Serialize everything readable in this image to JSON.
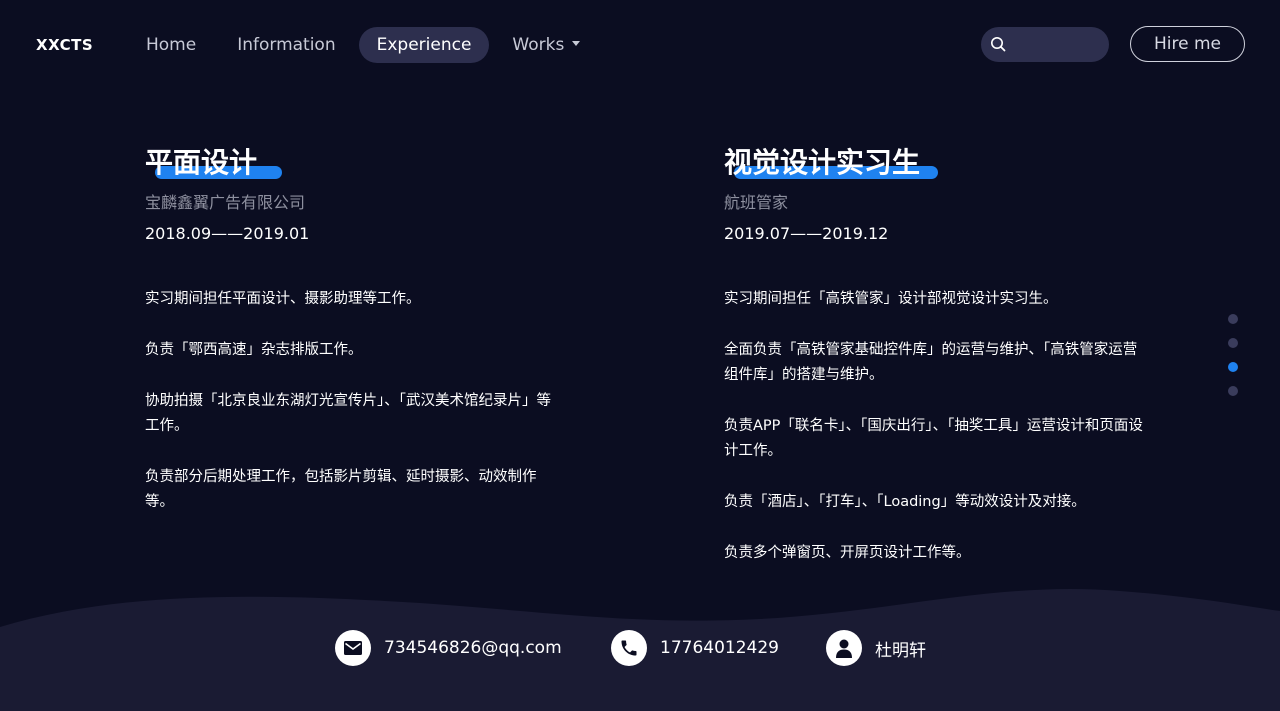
{
  "brand": {
    "logo": "XXCTS"
  },
  "nav": {
    "items": [
      {
        "label": "Home"
      },
      {
        "label": "Information"
      },
      {
        "label": "Experience"
      },
      {
        "label": "Works"
      }
    ]
  },
  "search": {
    "placeholder": ""
  },
  "hire_button": {
    "label": "Hire me"
  },
  "accent_color": "#1f82f0",
  "experience": [
    {
      "title": "平面设计",
      "company": "宝麟鑫翼广告有限公司",
      "period": "2018.09——2019.01",
      "duties": [
        "实习期间担任平面设计、摄影助理等工作。",
        "负责「鄂西高速」杂志排版工作。",
        "协助拍摄「北京良业东湖灯光宣传片」、「武汉美术馆纪录片」等工作。",
        "负责部分后期处理工作，包括影片剪辑、延时摄影、动效制作等。"
      ]
    },
    {
      "title": "视觉设计实习生",
      "company": "航班管家",
      "period": "2019.07——2019.12",
      "duties": [
        "实习期间担任「高铁管家」设计部视觉设计实习生。",
        "全面负责「高铁管家基础控件库」的运营与维护、「高铁管家运营组件库」的搭建与维护。",
        "负责APP「联名卡」、「国庆出行」、「抽奖工具」运营设计和页面设计工作。",
        "负责「酒店」、「打车」、「Loading」等动效设计及对接。",
        "负责多个弹窗页、开屏页设计工作等。"
      ]
    }
  ],
  "pagination": {
    "total": 4,
    "active_index": 2
  },
  "contact": {
    "email": "734546826@qq.com",
    "phone": "17764012429",
    "name": "杜明轩"
  }
}
